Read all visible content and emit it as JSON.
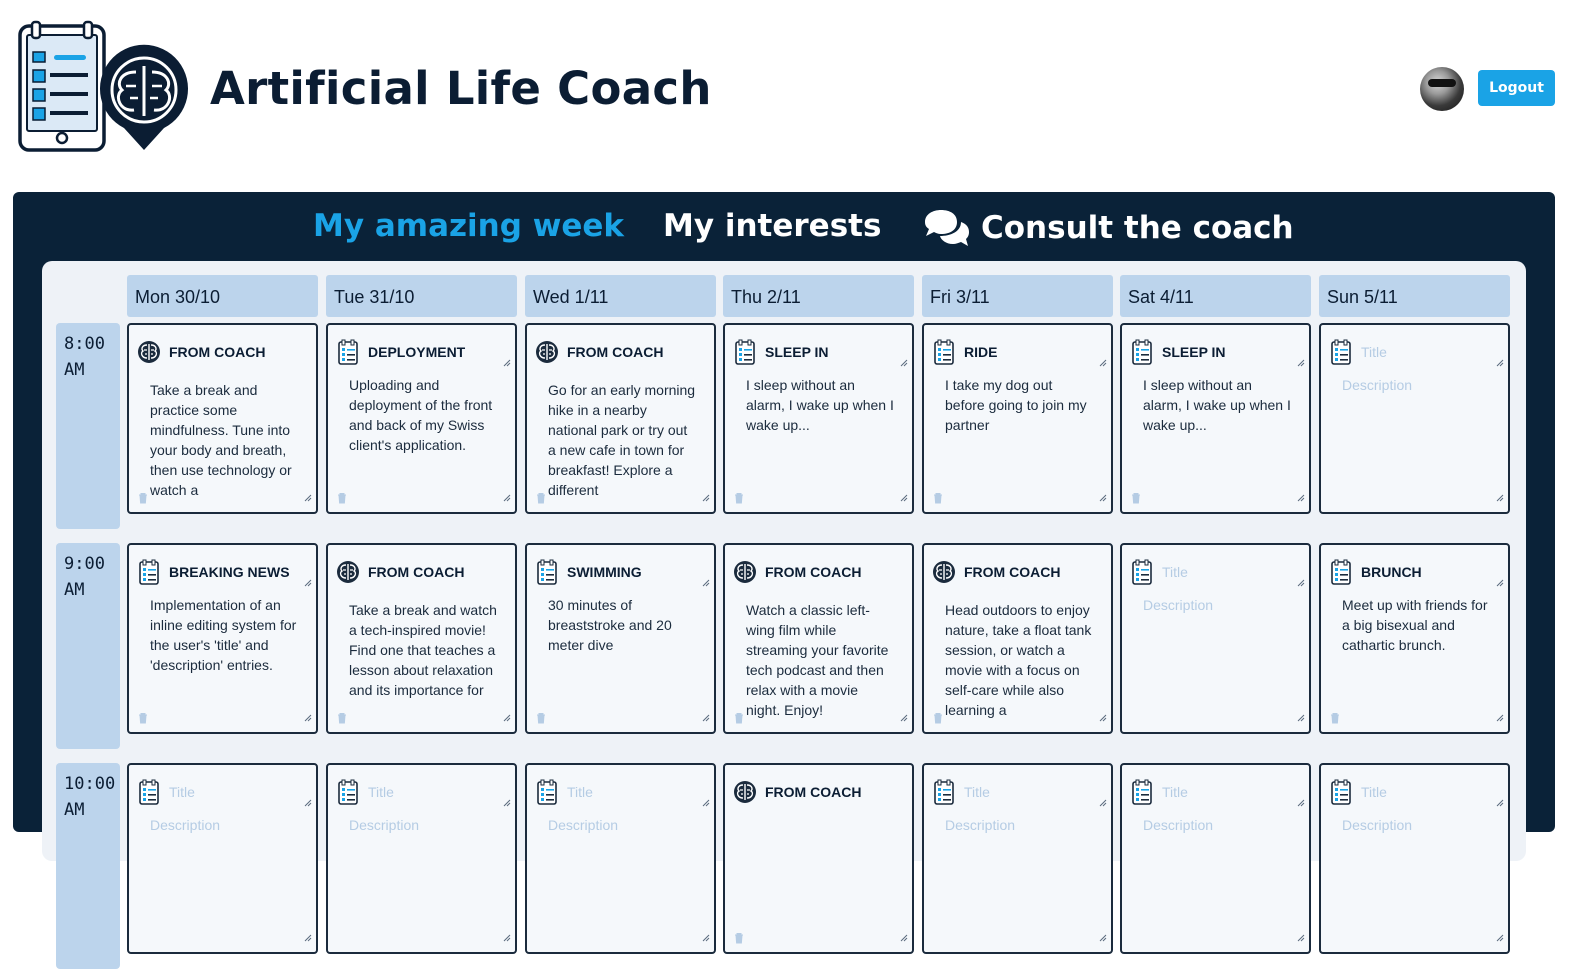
{
  "header": {
    "title": "Artificial Life Coach",
    "logo_icon": "checklist-brain-logo",
    "avatar_icon": "user-avatar",
    "logout_label": "Logout"
  },
  "colors": {
    "accent": "#1aa3e6",
    "panel": "#0a2238",
    "day_header": "#bcd4ec",
    "board": "#eef2f7"
  },
  "tabs": {
    "week": "My amazing week",
    "interests": "My interests",
    "coach": "Consult the coach",
    "coach_icon": "chat-bubbles-icon"
  },
  "days": [
    "Mon 30/10",
    "Tue 31/10",
    "Wed 1/11",
    "Thu 2/11",
    "Fri 3/11",
    "Sat 4/11",
    "Sun 5/11"
  ],
  "times": [
    {
      "hour": "8:00",
      "ampm": "AM"
    },
    {
      "hour": "9:00",
      "ampm": "AM"
    },
    {
      "hour": "10:00",
      "ampm": "AM"
    }
  ],
  "placeholders": {
    "title": "Title",
    "description": "Description"
  },
  "slots": [
    [
      {
        "icon": "brain",
        "title": "FROM COACH",
        "desc": "Take a break and practice some mindfulness. Tune into your body and breath, then use technology or watch a"
      },
      {
        "icon": "doc",
        "title": "DEPLOYMENT",
        "desc": "Uploading and deployment of the front and back of my Swiss client's application."
      },
      {
        "icon": "brain",
        "title": "FROM COACH",
        "desc": "Go for an early morning hike in a nearby national park or try out a new cafe in town for breakfast! Explore a different"
      },
      {
        "icon": "doc",
        "title": "SLEEP IN",
        "desc": "I sleep without an alarm, I wake up when I wake up..."
      },
      {
        "icon": "doc",
        "title": "RIDE",
        "desc": "I take my dog out before going to join my partner"
      },
      {
        "icon": "doc",
        "title": "SLEEP IN",
        "desc": "I sleep without an alarm, I wake up when I wake up..."
      },
      {
        "icon": "doc",
        "title": "",
        "desc": ""
      }
    ],
    [
      {
        "icon": "doc",
        "title": "BREAKING NEWS",
        "desc": "Implementation of an inline editing system for the user's 'title' and 'description' entries."
      },
      {
        "icon": "brain",
        "title": "FROM COACH",
        "desc": "Take a break and watch a tech-inspired movie! Find one that teaches a lesson about relaxation and its importance for"
      },
      {
        "icon": "doc",
        "title": "SWIMMING",
        "desc": "30 minutes of breaststroke and 20 meter dive"
      },
      {
        "icon": "brain",
        "title": "FROM COACH",
        "desc": "Watch a classic left-wing film while streaming your favorite tech podcast and then relax with a movie night. Enjoy!"
      },
      {
        "icon": "brain",
        "title": "FROM COACH",
        "desc": "Head outdoors to enjoy nature, take a float tank session, or watch a movie with a focus on self-care while also learning a"
      },
      {
        "icon": "doc",
        "title": "",
        "desc": ""
      },
      {
        "icon": "doc",
        "title": "BRUNCH",
        "desc": "Meet up with friends for a big bisexual and cathartic brunch."
      }
    ],
    [
      {
        "icon": "doc",
        "title": "",
        "desc": ""
      },
      {
        "icon": "doc",
        "title": "",
        "desc": ""
      },
      {
        "icon": "doc",
        "title": "",
        "desc": ""
      },
      {
        "icon": "brain",
        "title": "FROM COACH",
        "desc": ""
      },
      {
        "icon": "doc",
        "title": "",
        "desc": ""
      },
      {
        "icon": "doc",
        "title": "",
        "desc": ""
      },
      {
        "icon": "doc",
        "title": "",
        "desc": ""
      }
    ]
  ]
}
